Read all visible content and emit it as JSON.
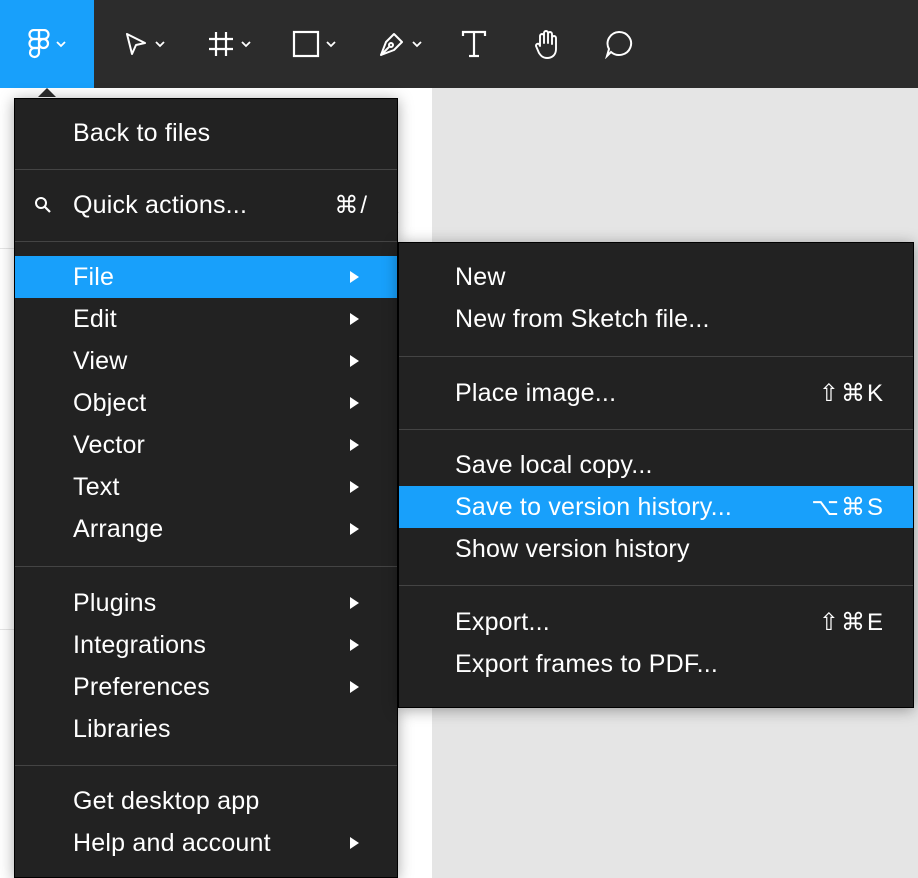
{
  "toolbar": {
    "colors": {
      "background": "#2c2c2c",
      "accent": "#18a0fb"
    },
    "tools": [
      {
        "name": "main-menu",
        "icon": "figma-logo-icon",
        "has_caret": true
      },
      {
        "name": "move",
        "icon": "move-pointer-icon",
        "has_caret": true
      },
      {
        "name": "frame",
        "icon": "frame-icon",
        "has_caret": true
      },
      {
        "name": "shape",
        "icon": "rectangle-icon",
        "has_caret": true
      },
      {
        "name": "pen",
        "icon": "pen-icon",
        "has_caret": true
      },
      {
        "name": "text",
        "icon": "text-icon",
        "has_caret": false
      },
      {
        "name": "hand",
        "icon": "hand-icon",
        "has_caret": false
      },
      {
        "name": "comment",
        "icon": "comment-icon",
        "has_caret": false
      }
    ]
  },
  "main_menu": {
    "back_to_files": "Back to files",
    "quick_actions": {
      "label": "Quick actions...",
      "shortcut": "⌘/",
      "icon": "search-icon"
    },
    "file": "File",
    "edit": "Edit",
    "view": "View",
    "object": "Object",
    "vector": "Vector",
    "text": "Text",
    "arrange": "Arrange",
    "plugins": "Plugins",
    "integrations": "Integrations",
    "preferences": "Preferences",
    "libraries": "Libraries",
    "get_desktop_app": "Get desktop app",
    "help_and_account": "Help and account"
  },
  "file_menu": {
    "new": "New",
    "new_from_sketch": "New from Sketch file...",
    "place_image": {
      "label": "Place image...",
      "shortcut": "⇧⌘K"
    },
    "save_local_copy": "Save local copy...",
    "save_to_version_history": {
      "label": "Save to version history...",
      "shortcut": "⌥⌘S"
    },
    "show_version_history": "Show version history",
    "export": {
      "label": "Export...",
      "shortcut": "⇧⌘E"
    },
    "export_frames_pdf": "Export frames to PDF..."
  }
}
